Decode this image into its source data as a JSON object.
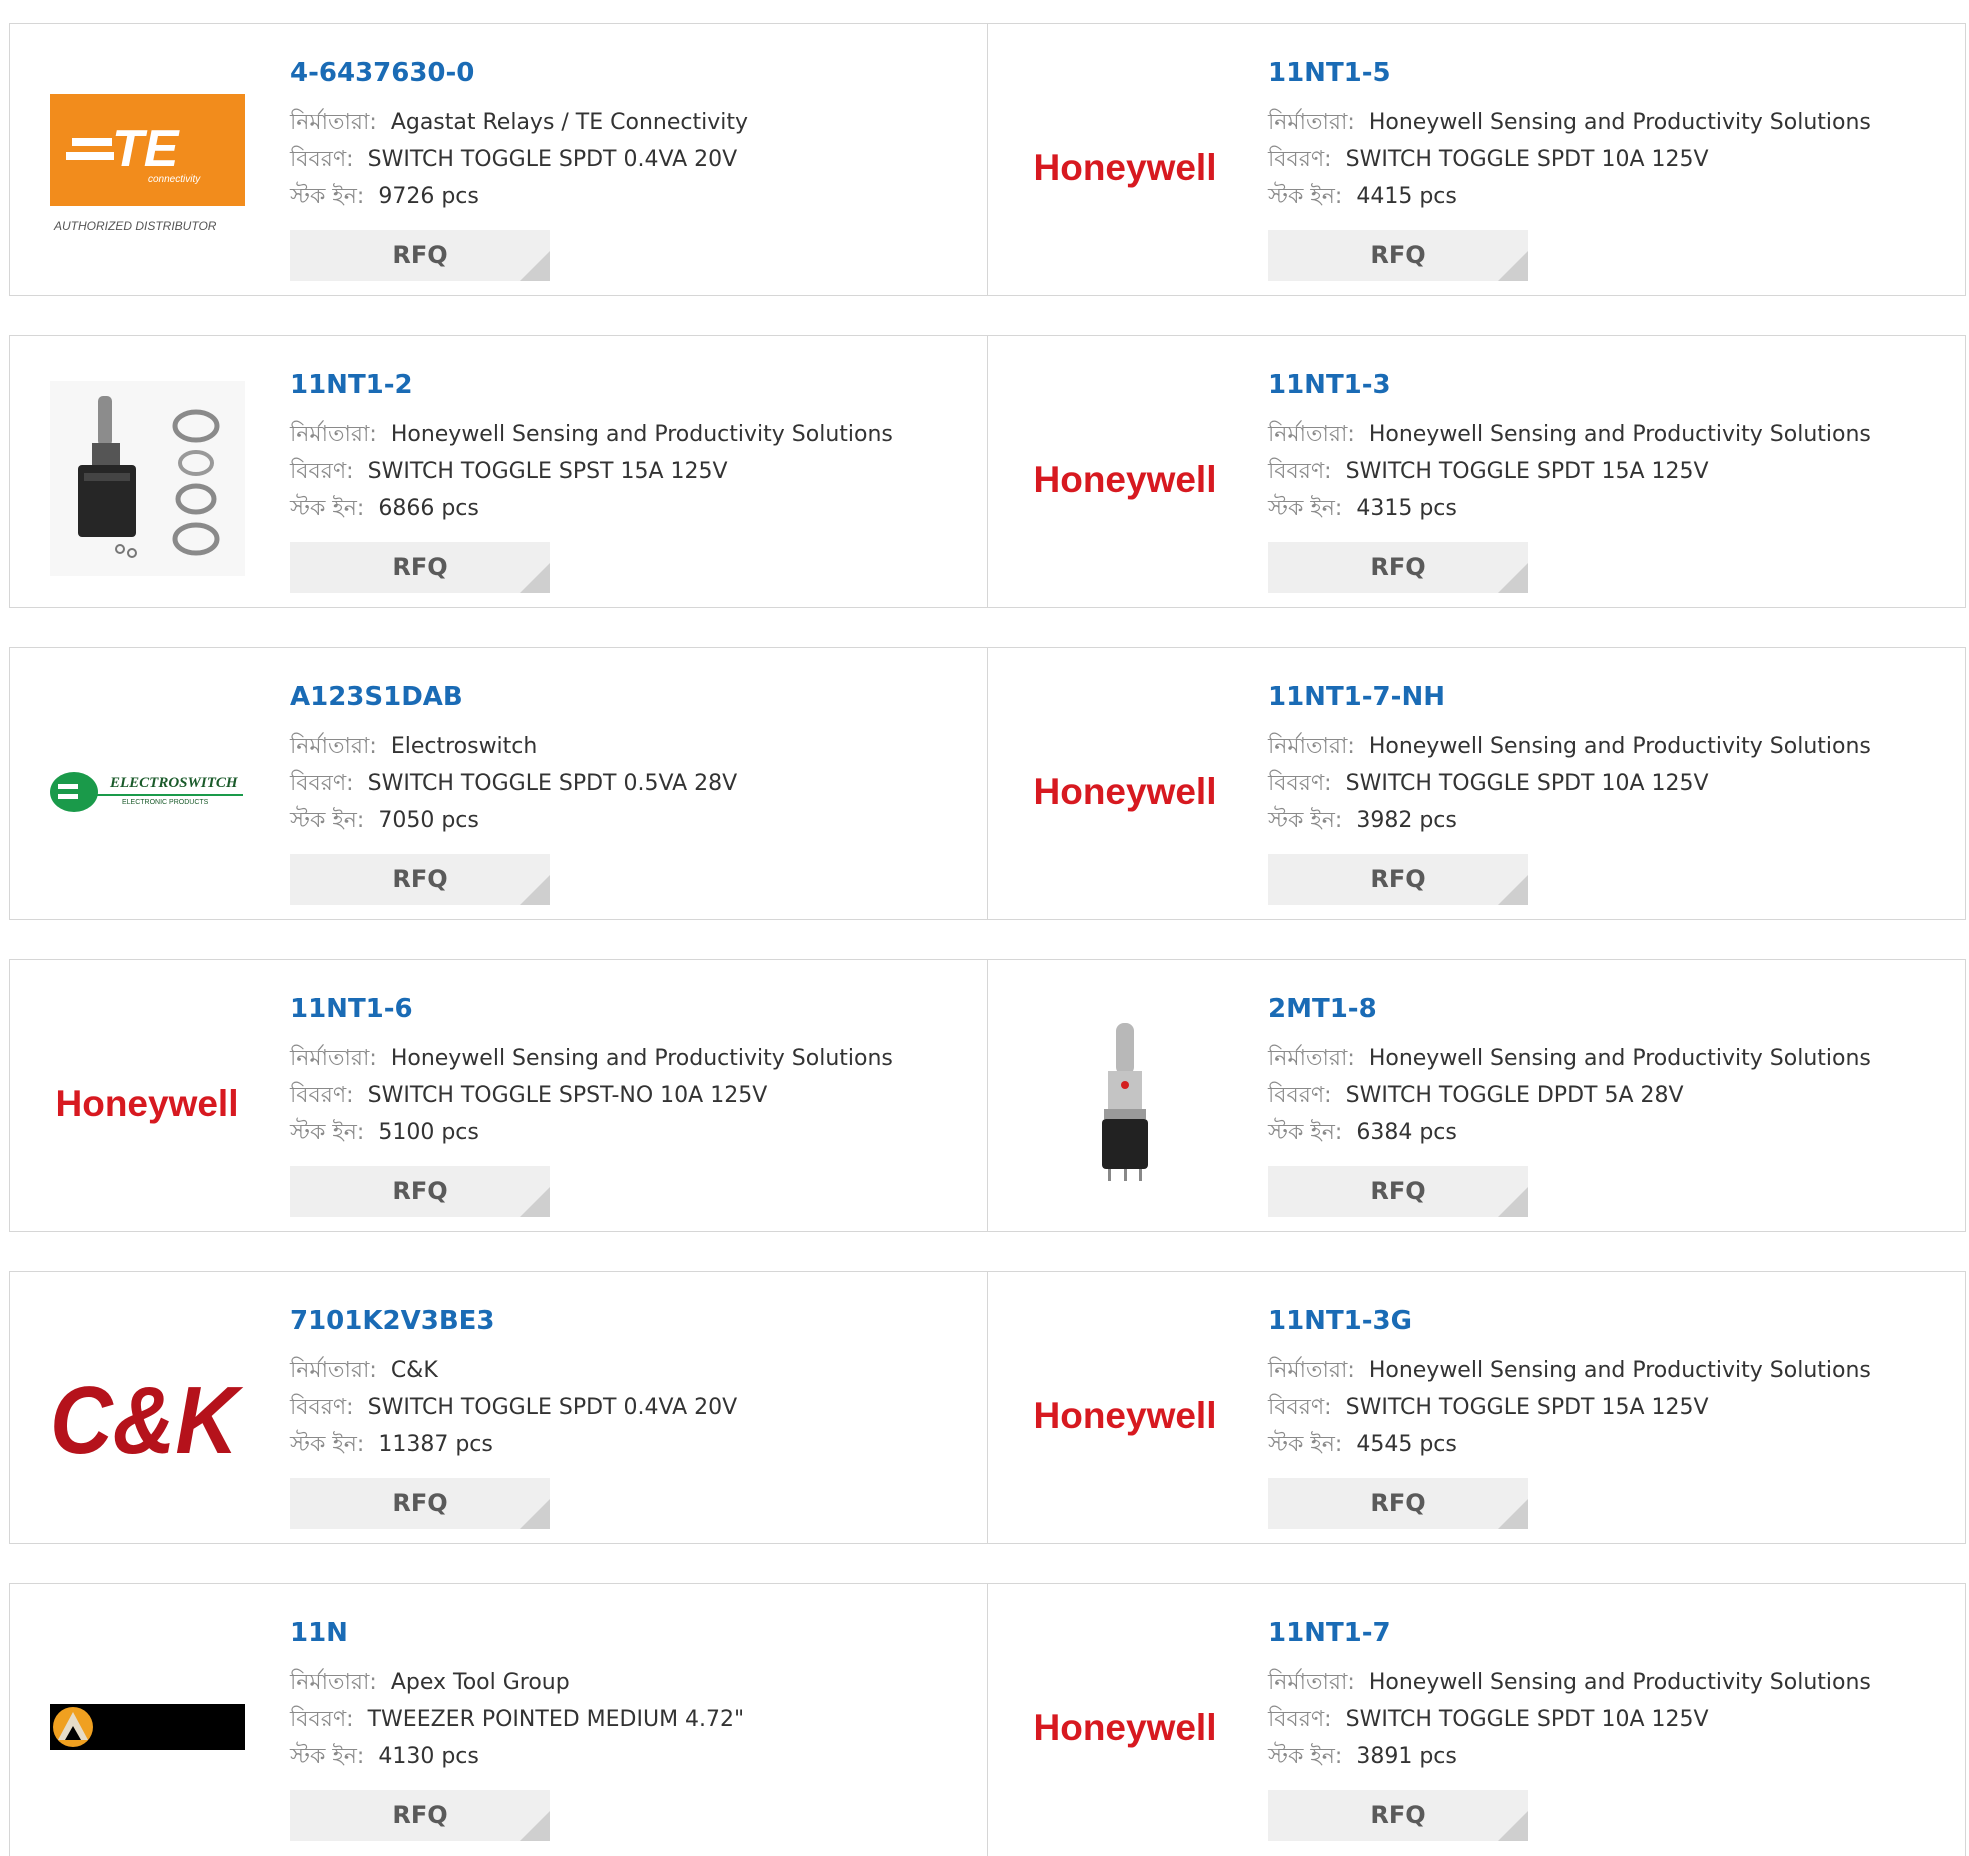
{
  "labels": {
    "manufacturer": "নির্মাতারা:",
    "description": "বিবরণ:",
    "stock": "স্টক ইন:",
    "rfq": "RFQ"
  },
  "products": [
    {
      "part_number": "4-6437630-0",
      "manufacturer": "Agastat Relays / TE Connectivity",
      "description": "SWITCH TOGGLE SPDT 0.4VA 20V",
      "stock": "9726 pcs",
      "logo": "te-connectivity-logo",
      "logo_text": "TE",
      "logo_subtext": "connectivity",
      "logo_caption": "AUTHORIZED DISTRIBUTOR"
    },
    {
      "part_number": "11NT1-5",
      "manufacturer": "Honeywell Sensing and Productivity Solutions",
      "description": "SWITCH TOGGLE SPDT 10A 125V",
      "stock": "4415 pcs",
      "logo": "honeywell-logo",
      "logo_text": "Honeywell"
    },
    {
      "part_number": "11NT1-2",
      "manufacturer": "Honeywell Sensing and Productivity Solutions",
      "description": "SWITCH TOGGLE SPST 15A 125V",
      "stock": "6866 pcs",
      "logo": "toggle-switch-photo-with-nuts"
    },
    {
      "part_number": "11NT1-3",
      "manufacturer": "Honeywell Sensing and Productivity Solutions",
      "description": "SWITCH TOGGLE SPDT 15A 125V",
      "stock": "4315 pcs",
      "logo": "honeywell-logo",
      "logo_text": "Honeywell"
    },
    {
      "part_number": "A123S1DAB",
      "manufacturer": "Electroswitch",
      "description": "SWITCH TOGGLE SPDT 0.5VA 28V",
      "stock": "7050 pcs",
      "logo": "electroswitch-logo",
      "logo_text": "ELECTROSWITCH",
      "logo_subtext": "ELECTRONIC PRODUCTS"
    },
    {
      "part_number": "11NT1-7-NH",
      "manufacturer": "Honeywell Sensing and Productivity Solutions",
      "description": "SWITCH TOGGLE SPDT 10A 125V",
      "stock": "3982 pcs",
      "logo": "honeywell-logo",
      "logo_text": "Honeywell"
    },
    {
      "part_number": "11NT1-6",
      "manufacturer": "Honeywell Sensing and Productivity Solutions",
      "description": "SWITCH TOGGLE SPST-NO 10A 125V",
      "stock": "5100 pcs",
      "logo": "honeywell-logo",
      "logo_text": "Honeywell"
    },
    {
      "part_number": "2MT1-8",
      "manufacturer": "Honeywell Sensing and Productivity Solutions",
      "description": "SWITCH TOGGLE DPDT 5A 28V",
      "stock": "6384 pcs",
      "logo": "toggle-switch-photo"
    },
    {
      "part_number": "7101K2V3BE3",
      "manufacturer": "C&K",
      "description": "SWITCH TOGGLE SPDT 0.4VA 20V",
      "stock": "11387 pcs",
      "logo": "ck-logo",
      "logo_text": "C&K"
    },
    {
      "part_number": "11NT1-3G",
      "manufacturer": "Honeywell Sensing and Productivity Solutions",
      "description": "SWITCH TOGGLE SPDT 15A 125V",
      "stock": "4545 pcs",
      "logo": "honeywell-logo",
      "logo_text": "Honeywell"
    },
    {
      "part_number": "11N",
      "manufacturer": "Apex Tool Group",
      "description": "TWEEZER POINTED MEDIUM 4.72\"",
      "stock": "4130 pcs",
      "logo": "apex-tool-group-logo"
    },
    {
      "part_number": "11NT1-7",
      "manufacturer": "Honeywell Sensing and Productivity Solutions",
      "description": "SWITCH TOGGLE SPDT 10A 125V",
      "stock": "3891 pcs",
      "logo": "honeywell-logo",
      "logo_text": "Honeywell"
    }
  ],
  "colors": {
    "link": "#1a6bb5",
    "honeywell_red": "#d71920",
    "te_orange": "#f28c1c",
    "ck_red": "#b5121b",
    "electroswitch_green": "#1a9a4a",
    "rfq_bg": "#efefef",
    "border": "#d6d6d6"
  }
}
